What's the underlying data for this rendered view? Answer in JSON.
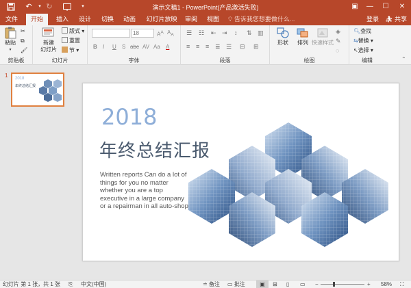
{
  "window": {
    "title": "演示文稿1 - PowerPoint(产品激活失败)",
    "quick_access": {
      "save": "save-icon",
      "undo": "undo-icon",
      "redo": "redo-icon",
      "start": "start-slideshow-icon",
      "customize": "customize-icon"
    },
    "controls": {
      "ribbon_options": "▣",
      "minimize": "—",
      "maximize": "☐",
      "close": "✕"
    },
    "accent": "#b7472a"
  },
  "tabs": [
    {
      "label": "文件"
    },
    {
      "label": "开始",
      "active": true
    },
    {
      "label": "插入"
    },
    {
      "label": "设计"
    },
    {
      "label": "切换"
    },
    {
      "label": "动画"
    },
    {
      "label": "幻灯片放映"
    },
    {
      "label": "审阅"
    },
    {
      "label": "视图"
    }
  ],
  "tell_me": "告诉我您想要做什么...",
  "account": {
    "login": "登录",
    "share": "共享"
  },
  "ribbon": {
    "clipboard": {
      "label": "剪贴板",
      "paste": "粘贴"
    },
    "slides": {
      "label": "幻灯片",
      "new_slide_1": "新建",
      "new_slide_2": "幻灯片",
      "layout": "版式",
      "reset": "重置",
      "section": "节"
    },
    "font": {
      "label": "字体",
      "font_size": "18",
      "buttons": [
        "B",
        "I",
        "U",
        "S",
        "abc",
        "AV",
        "Aa",
        "A"
      ]
    },
    "paragraph": {
      "label": "段落"
    },
    "drawing": {
      "label": "绘图",
      "shapes": "形状",
      "arrange": "排列",
      "quick_styles": "快速样式"
    },
    "editing": {
      "label": "编辑",
      "find": "查找",
      "replace": "替换",
      "select": "选择"
    }
  },
  "slides_panel": {
    "number": "1"
  },
  "slide": {
    "year": "2018",
    "title": "年终总结汇报",
    "body": "Written reports Can do a lot of things for you no matter whether you are a top executive in a large company or a repairman in all auto-shop"
  },
  "status": {
    "slide_info": "幻灯片 第 1 张，共 1 张",
    "language": "中文(中国)",
    "notes": "备注",
    "comments": "批注",
    "zoom_percent": "58%",
    "zoom_level": 0.58
  }
}
